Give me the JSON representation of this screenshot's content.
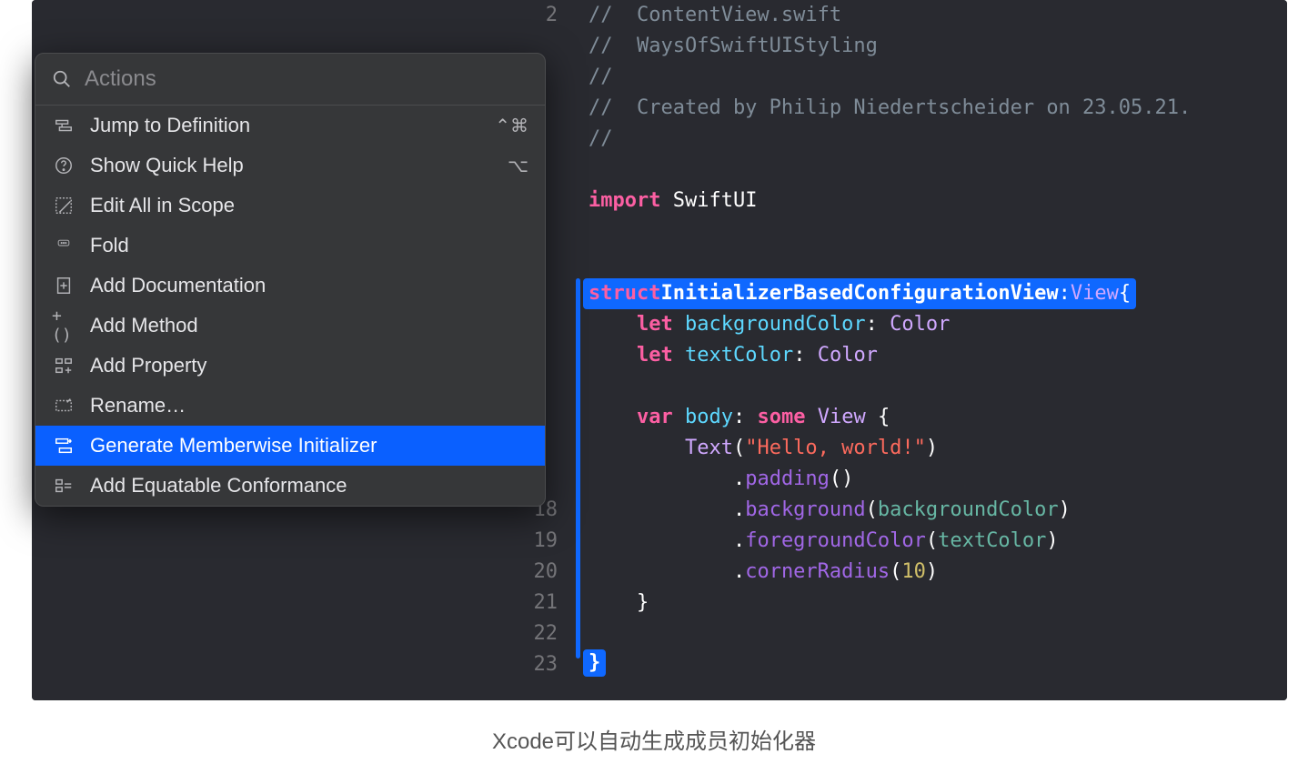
{
  "popup": {
    "search_placeholder": "Actions",
    "items": [
      {
        "icon": "jump-icon",
        "label": "Jump to Definition",
        "shortcut": "⌃⌘"
      },
      {
        "icon": "help-icon",
        "label": "Show Quick Help",
        "shortcut": "⌥"
      },
      {
        "icon": "scope-icon",
        "label": "Edit All in Scope",
        "shortcut": ""
      },
      {
        "icon": "fold-icon",
        "label": "Fold",
        "shortcut": ""
      },
      {
        "icon": "adddoc-icon",
        "label": "Add Documentation",
        "shortcut": ""
      },
      {
        "icon": "method-icon",
        "label": "Add Method",
        "shortcut": ""
      },
      {
        "icon": "prop-icon",
        "label": "Add Property",
        "shortcut": ""
      },
      {
        "icon": "rename-icon",
        "label": "Rename…",
        "shortcut": ""
      },
      {
        "icon": "init-icon",
        "label": "Generate Memberwise Initializer",
        "shortcut": ""
      },
      {
        "icon": "eq-icon",
        "label": "Add Equatable Conformance",
        "shortcut": ""
      }
    ],
    "selected_index": 8
  },
  "line_numbers": [
    "2",
    "",
    "",
    "",
    "",
    "",
    "",
    "",
    "",
    "",
    "",
    "",
    "",
    "",
    "",
    "",
    "18",
    "19",
    "20",
    "21",
    "22",
    "23"
  ],
  "code": {
    "l2": "//  ContentView.swift",
    "l3": "//  WaysOfSwiftUIStyling",
    "l4": "//",
    "l5": "//  Created by Philip Niedertscheider on 23.05.21.",
    "l6": "//",
    "import_kw": "import",
    "import_mod": "SwiftUI",
    "struct_kw": "struct",
    "struct_name": "InitializerBasedConfigurationView",
    "view_type": "View",
    "let_kw": "let",
    "bg_prop": "backgroundColor",
    "color_type": "Color",
    "txt_prop": "textColor",
    "var_kw": "var",
    "body_prop": "body",
    "some_kw": "some",
    "text_type": "Text",
    "hello_str": "\"Hello, world!\"",
    "padding": "padding",
    "bg_method": "background",
    "bg_arg": "backgroundColor",
    "fg_method": "foregroundColor",
    "fg_arg": "textColor",
    "cr_method": "cornerRadius",
    "cr_arg": "10",
    "open_brace": "{",
    "close_brace": "}",
    "colon": ":",
    "paren_open": "(",
    "paren_close": ")",
    "dot": "."
  },
  "caption": "Xcode可以自动生成成员初始化器"
}
